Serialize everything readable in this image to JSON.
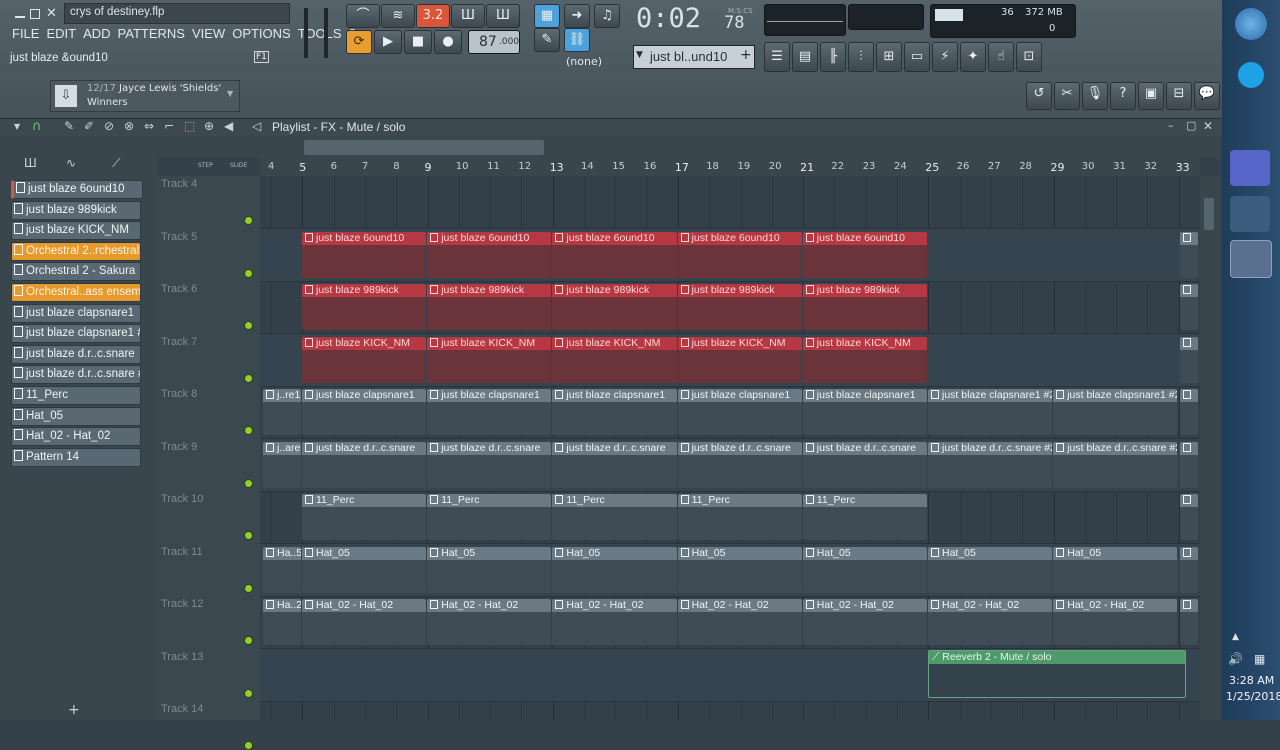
{
  "header": {
    "project_file": "crys of destiney.flp",
    "menu": [
      "FILE",
      "EDIT",
      "ADD",
      "PATTERNS",
      "VIEW",
      "OPTIONS",
      "TOOLS",
      "?"
    ],
    "hint_text": "just blaze &ound10",
    "hint_key": "F1",
    "tempo": "87",
    "tempo_frac": ".000",
    "time_display": "0:02",
    "time_frac": "78",
    "time_label": "M:S:CS",
    "pattern_selector": "(none)",
    "pattern_name": "just bl..und10",
    "cpu_value": "36",
    "memory": "372 MB",
    "poly_count": "0",
    "pattern_label": "3.2"
  },
  "news": {
    "counter": "12/17",
    "line1": "Jayce Lewis 'Shields'",
    "line2": "Winners"
  },
  "playlist": {
    "title": "Playlist - FX - Mute / solo",
    "step_label": "STEP",
    "slide_label": "SLIDE"
  },
  "patterns": [
    {
      "label": "just blaze 6ound10",
      "orange": false
    },
    {
      "label": "just blaze 989kick",
      "orange": false
    },
    {
      "label": "just blaze KICK_NM",
      "orange": false
    },
    {
      "label": "Orchestral 2..rchestral 2",
      "orange": true
    },
    {
      "label": "Orchestral 2 - Sakura",
      "orange": false
    },
    {
      "label": "Orchestral..ass ensemble",
      "orange": true
    },
    {
      "label": "just blaze clapsnare1",
      "orange": false
    },
    {
      "label": "just blaze clapsnare1 #2",
      "orange": false
    },
    {
      "label": "just blaze d.r..c.snare",
      "orange": false
    },
    {
      "label": "just blaze d.r..c.snare #2",
      "orange": false
    },
    {
      "label": "11_Perc",
      "orange": false
    },
    {
      "label": "Hat_05",
      "orange": false
    },
    {
      "label": "Hat_02 - Hat_02",
      "orange": false
    },
    {
      "label": "Pattern 14",
      "orange": false
    }
  ],
  "ruler": [
    "4",
    "5",
    "6",
    "7",
    "8",
    "9",
    "10",
    "11",
    "12",
    "13",
    "14",
    "15",
    "16",
    "17",
    "18",
    "19",
    "20",
    "21",
    "22",
    "23",
    "24",
    "25",
    "26",
    "27",
    "28",
    "29",
    "30",
    "31",
    "32",
    "33"
  ],
  "tracks": [
    {
      "name": "Track 4",
      "clips": []
    },
    {
      "name": "Track 5",
      "clips": [
        "just blaze 6ound10",
        "just blaze 6ound10",
        "just blaze 6ound10",
        "just blaze 6ound10",
        "just blaze 6ound10"
      ]
    },
    {
      "name": "Track 6",
      "clips": [
        "just blaze 989kick",
        "just blaze 989kick",
        "just blaze 989kick",
        "just blaze 989kick",
        "just blaze 989kick"
      ]
    },
    {
      "name": "Track 7",
      "clips": [
        "just blaze KICK_NM",
        "just blaze KICK_NM",
        "just blaze KICK_NM",
        "just blaze KICK_NM",
        "just blaze KICK_NM"
      ]
    },
    {
      "name": "Track 8",
      "lead": "j..re1",
      "clips": [
        "just blaze clapsnare1",
        "just blaze clapsnare1",
        "just blaze clapsnare1",
        "just blaze clapsnare1",
        "just blaze clapsnare1",
        "just blaze clapsnare1 #2",
        "just blaze clapsnare1 #2"
      ]
    },
    {
      "name": "Track 9",
      "lead": "j..are",
      "clips": [
        "just blaze d.r..c.snare",
        "just blaze d.r..c.snare",
        "just blaze d.r..c.snare",
        "just blaze d.r..c.snare",
        "just blaze d.r..c.snare",
        "just blaze d.r..c.snare #2",
        "just blaze d.r..c.snare #2"
      ]
    },
    {
      "name": "Track 10",
      "clips": [
        "11_Perc",
        "11_Perc",
        "11_Perc",
        "11_Perc",
        "11_Perc"
      ]
    },
    {
      "name": "Track 11",
      "lead": "Ha..5",
      "clips": [
        "Hat_05",
        "Hat_05",
        "Hat_05",
        "Hat_05",
        "Hat_05",
        "Hat_05",
        "Hat_05"
      ]
    },
    {
      "name": "Track 12",
      "lead": "Ha..2",
      "clips": [
        "Hat_02 - Hat_02",
        "Hat_02 - Hat_02",
        "Hat_02 - Hat_02",
        "Hat_02 - Hat_02",
        "Hat_02 - Hat_02",
        "Hat_02 - Hat_02",
        "Hat_02 - Hat_02"
      ]
    },
    {
      "name": "Track 13",
      "clips": [],
      "automation": "Reeverb 2 - Mute / solo"
    },
    {
      "name": "Track 14",
      "clips": []
    }
  ],
  "taskbar": {
    "time": "3:28 AM",
    "date": "1/25/2018"
  },
  "colors": {
    "clip_red": "#b53843",
    "clip_grey": "#6b7984",
    "pattern_orange": "#e69a2e",
    "automation_green": "#4f9a6a"
  }
}
